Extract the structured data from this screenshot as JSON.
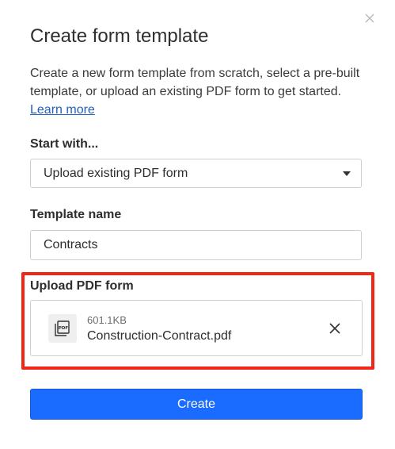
{
  "dialog": {
    "title": "Create form template",
    "description": "Create a new form template from scratch, select a pre-built template, or upload an existing PDF form to get started.",
    "learn_more": "Learn more",
    "close_icon": "close-icon"
  },
  "start_with": {
    "label": "Start with...",
    "selected": "Upload existing PDF form"
  },
  "template_name": {
    "label": "Template name",
    "value": "Contracts"
  },
  "upload": {
    "label": "Upload PDF form",
    "file": {
      "size": "601.1KB",
      "name": "Construction-Contract.pdf",
      "icon": "pdf-file-icon"
    },
    "remove_icon": "close-icon"
  },
  "actions": {
    "create_label": "Create"
  },
  "colors": {
    "primary": "#1a6bff",
    "highlight": "#ee2716",
    "link": "#1f5fbf"
  }
}
